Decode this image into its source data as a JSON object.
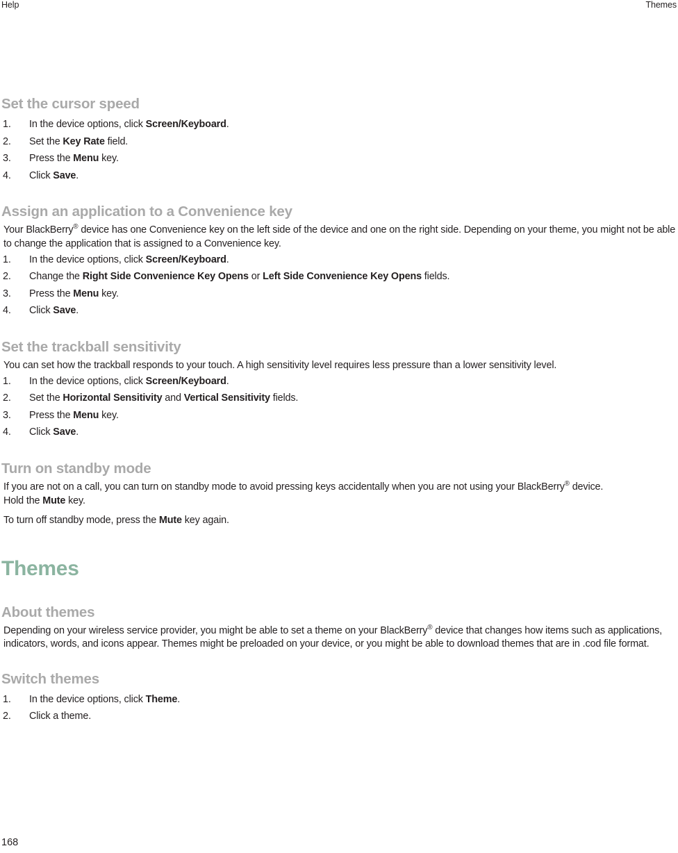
{
  "header": {
    "left": "Help",
    "right": "Themes"
  },
  "footer": {
    "page_number": "168"
  },
  "colors": {
    "chapter_heading": "#8bb4a0",
    "section_heading": "#a9a9a9",
    "body_text": "#231f20",
    "page_background": "#ffffff"
  },
  "sections": {
    "cursor_speed": {
      "heading": "Set the cursor speed",
      "steps": [
        {
          "prefix": "In the device options, click ",
          "bold": "Screen/Keyboard",
          "suffix": "."
        },
        {
          "prefix": "Set the ",
          "bold": "Key Rate",
          "suffix": " field."
        },
        {
          "prefix": "Press the ",
          "bold": "Menu",
          "suffix": " key."
        },
        {
          "prefix": "Click ",
          "bold": "Save",
          "suffix": "."
        }
      ]
    },
    "convenience_key": {
      "heading": "Assign an application to a Convenience key",
      "intro": "Your BlackBerry® device has one Convenience key on the left side of the device and one on the right side. Depending on your theme, you might not be able to change the application that is assigned to a Convenience key.",
      "steps": [
        {
          "prefix": "In the device options, click ",
          "bold": "Screen/Keyboard",
          "suffix": "."
        },
        {
          "prefix": "Change the ",
          "bold": "Right Side Convenience Key Opens",
          "middle": " or ",
          "bold2": "Left Side Convenience Key Opens",
          "suffix": " fields."
        },
        {
          "prefix": "Press the ",
          "bold": "Menu",
          "suffix": " key."
        },
        {
          "prefix": "Click ",
          "bold": "Save",
          "suffix": "."
        }
      ]
    },
    "trackball_sensitivity": {
      "heading": "Set the trackball sensitivity",
      "intro": "You can set how the trackball responds to your touch. A high sensitivity level requires less pressure than a lower sensitivity level.",
      "steps": [
        {
          "prefix": "In the device options, click ",
          "bold": "Screen/Keyboard",
          "suffix": "."
        },
        {
          "prefix": "Set the ",
          "bold": "Horizontal Sensitivity",
          "middle": " and ",
          "bold2": "Vertical Sensitivity",
          "suffix": " fields."
        },
        {
          "prefix": "Press the ",
          "bold": "Menu",
          "suffix": " key."
        },
        {
          "prefix": "Click ",
          "bold": "Save",
          "suffix": "."
        }
      ]
    },
    "standby_mode": {
      "heading": "Turn on standby mode",
      "para1": "If you are not on a call, you can turn on standby mode to avoid pressing keys accidentally when you are not using your BlackBerry® device.",
      "para2_prefix": "Hold the ",
      "para2_bold": "Mute",
      "para2_suffix": " key.",
      "para3_prefix": "To turn off standby mode, press the ",
      "para3_bold": "Mute",
      "para3_suffix": " key again."
    },
    "themes_chapter": {
      "heading": "Themes"
    },
    "about_themes": {
      "heading": "About themes",
      "body": "Depending on your wireless service provider, you might be able to set a theme on your BlackBerry® device that changes how items such as applications, indicators, words, and icons appear. Themes might be preloaded on your device, or you might be able to download themes that are in .cod file format."
    },
    "switch_themes": {
      "heading": "Switch themes",
      "steps": [
        {
          "prefix": "In the device options, click ",
          "bold": "Theme",
          "suffix": "."
        },
        {
          "prefix": "Click a theme.",
          "bold": "",
          "suffix": ""
        }
      ]
    }
  }
}
